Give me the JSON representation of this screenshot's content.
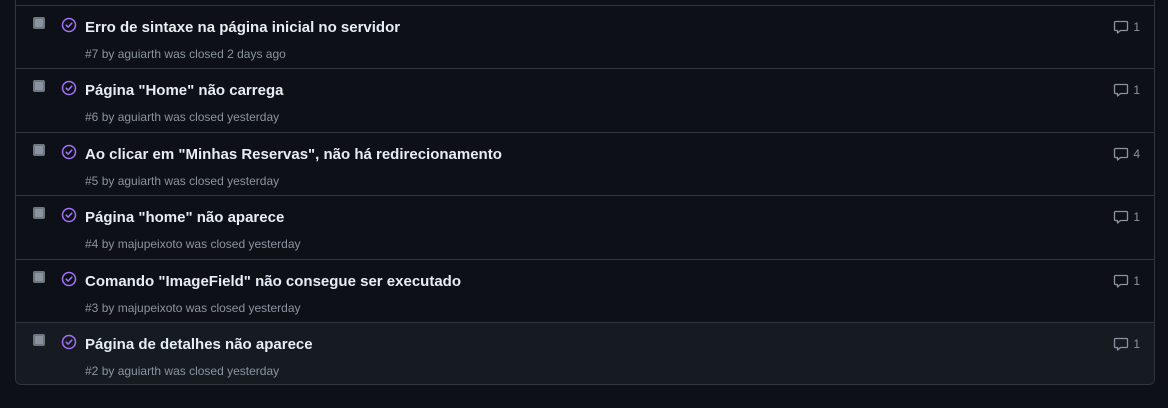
{
  "colors": {
    "background": "#0d1117",
    "border": "#30363d",
    "title": "#e6edf3",
    "muted": "#8b949e",
    "closed_state": "#a371f7"
  },
  "icons": {
    "state": "issue-closed-icon",
    "comments": "comment-icon"
  },
  "issues": [
    {
      "title": "Erro de sintaxe na página inicial no servidor",
      "number": "#7",
      "author": "aguiarth",
      "status_text": "was closed 2 days ago",
      "comments": "1"
    },
    {
      "title": "Página \"Home\" não carrega",
      "number": "#6",
      "author": "aguiarth",
      "status_text": "was closed yesterday",
      "comments": "1"
    },
    {
      "title": "Ao clicar em \"Minhas Reservas\", não há redirecionamento",
      "number": "#5",
      "author": "aguiarth",
      "status_text": "was closed yesterday",
      "comments": "4"
    },
    {
      "title": "Página \"home\" não aparece",
      "number": "#4",
      "author": "majupeixoto",
      "status_text": "was closed yesterday",
      "comments": "1"
    },
    {
      "title": "Comando \"ImageField\" não consegue ser executado",
      "number": "#3",
      "author": "majupeixoto",
      "status_text": "was closed yesterday",
      "comments": "1"
    },
    {
      "title": "Página de detalhes não aparece",
      "number": "#2",
      "author": "aguiarth",
      "status_text": "was closed yesterday",
      "comments": "1"
    }
  ]
}
